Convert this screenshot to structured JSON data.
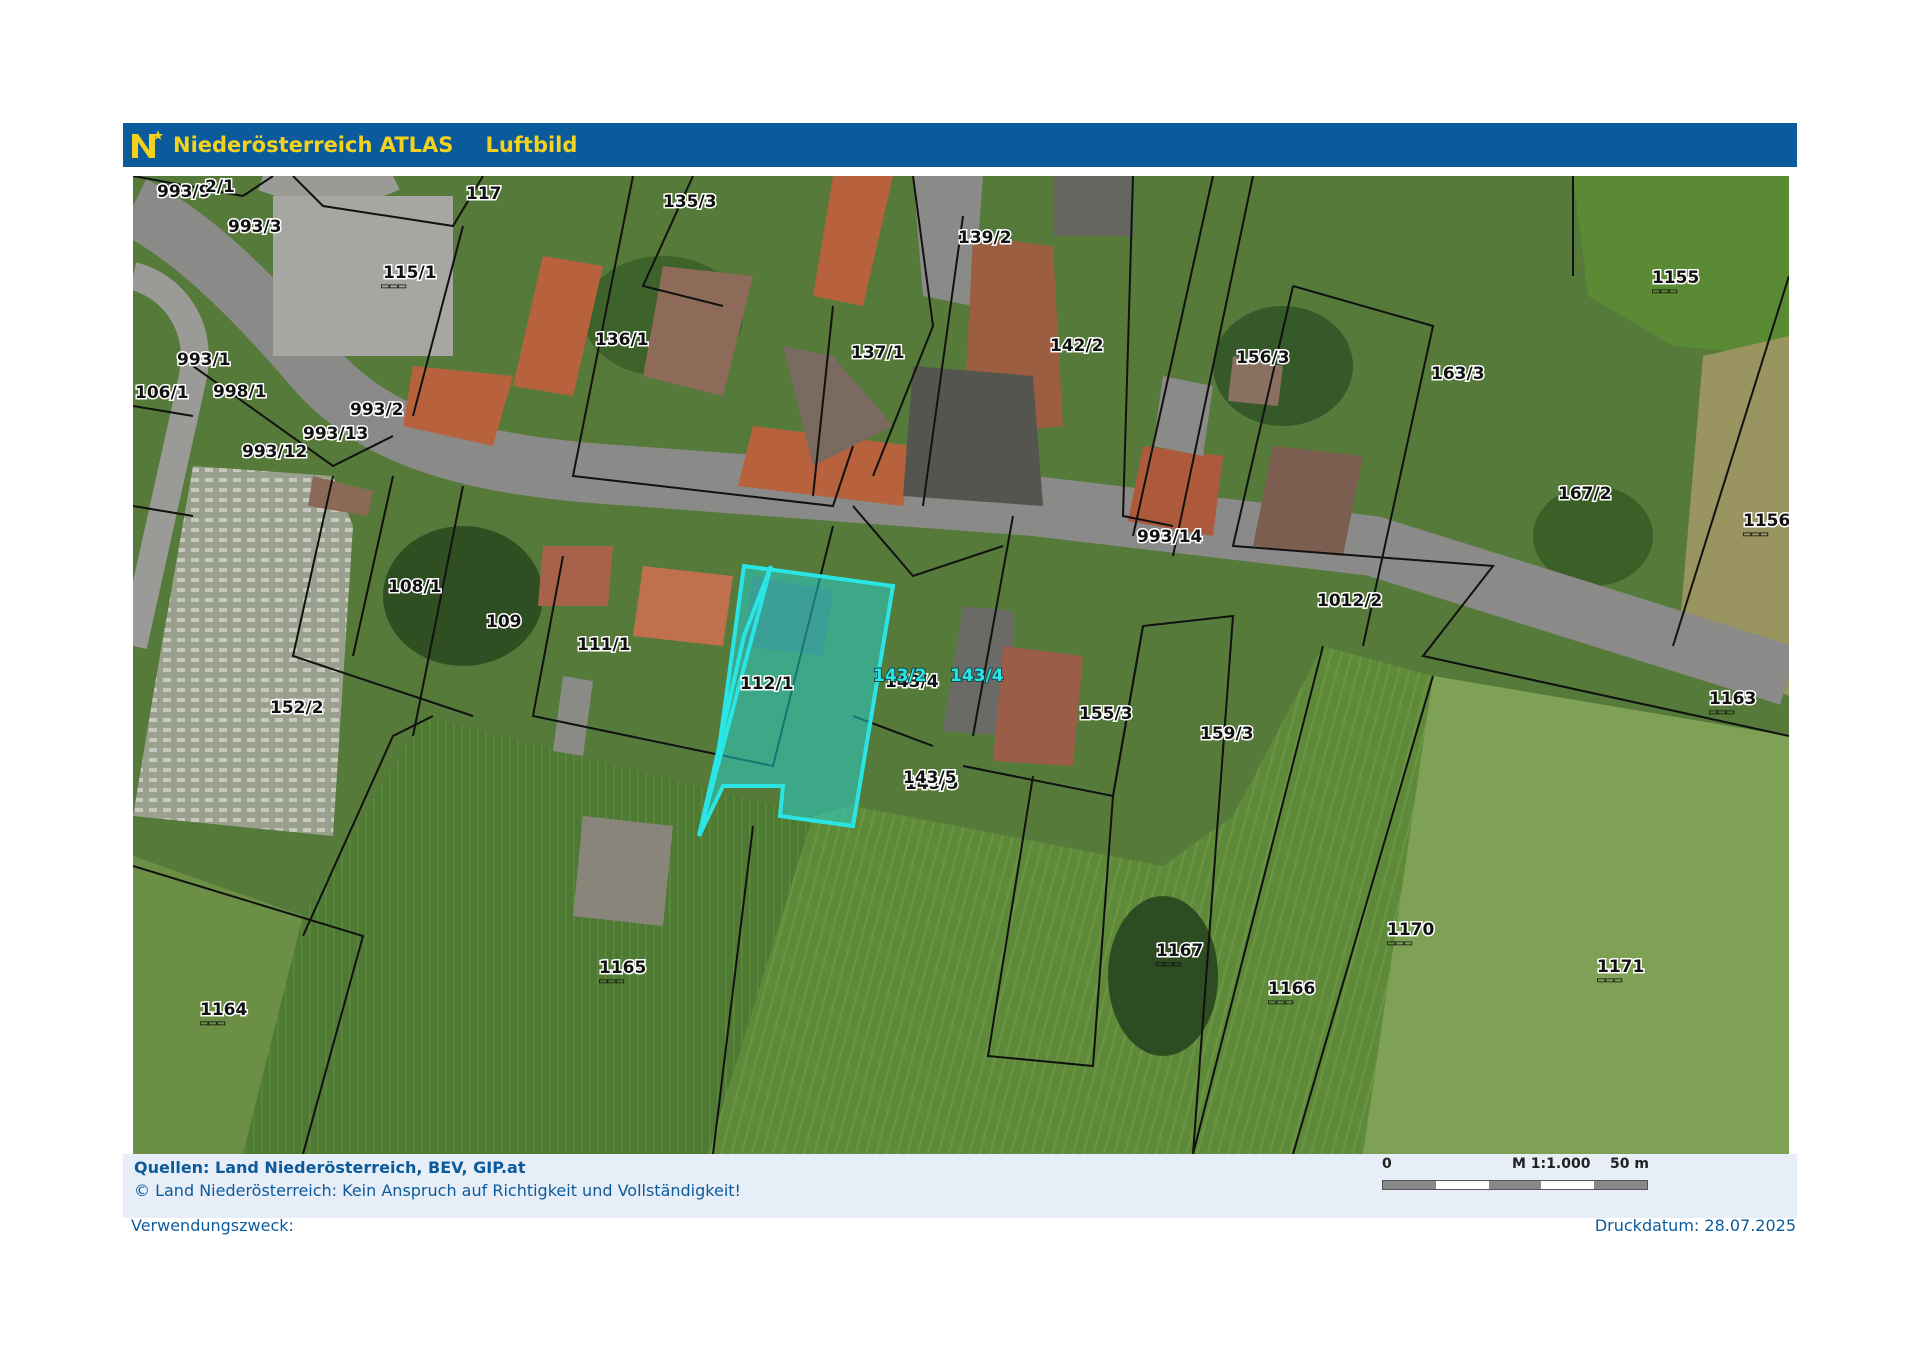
{
  "header": {
    "logo_letter": "N",
    "app_title": "Niederösterreich ATLAS",
    "layer_name": "Luftbild"
  },
  "map": {
    "imagery": "aerial",
    "highlight_color": "#25d5d5",
    "parcels": [
      "993/9",
      "2/1",
      "117",
      "135/3",
      "993/3",
      "115/1",
      "139/2",
      "136/1",
      "137/1",
      "142/2",
      "156/3",
      "163/3",
      "1155",
      "993/1",
      "106/1",
      "998/1",
      "993/2",
      "993/13",
      "993/12",
      "167/2",
      "1156",
      "993/14",
      "108/1",
      "109",
      "111/1",
      "1012/2",
      "143/2",
      "143/4",
      "112/1",
      "155/3",
      "152/2",
      "159/3",
      "1163",
      "143/5",
      "1170",
      "1167",
      "1165",
      "1171",
      "1166",
      "1164"
    ]
  },
  "footer": {
    "sources": "Quellen: Land Niederösterreich, BEV, GIP.at",
    "copyright": "© Land Niederösterreich: Kein Anspruch auf Richtigkeit und Vollständigkeit!",
    "scale_start": "0",
    "scale_ratio": "M 1:1.000",
    "scale_end": "50 m",
    "purpose_label": "Verwendungszweck:",
    "print_date": "Druckdatum: 28.07.2025"
  }
}
